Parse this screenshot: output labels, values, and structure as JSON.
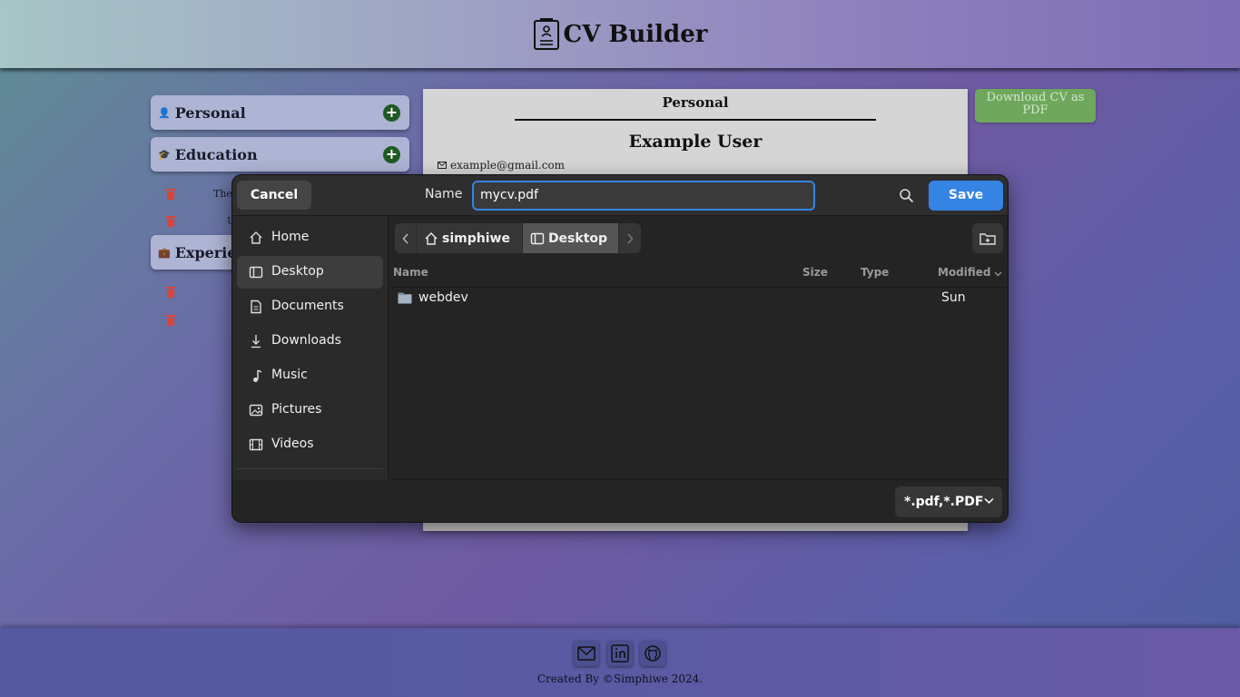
{
  "app": {
    "title": "CV Builder",
    "colors": {
      "add_button": "#1f5a24",
      "delete_icon": "#d9453a",
      "download_button": "#6fa85c"
    }
  },
  "sidebar": {
    "sections": [
      {
        "label": "Personal",
        "icon": "person-icon"
      },
      {
        "label": "Education",
        "icon": "graduation-icon"
      },
      {
        "label": "Experien",
        "icon": "briefcase-icon"
      }
    ],
    "education_entries": [
      "The",
      "U"
    ]
  },
  "cv_preview": {
    "section_title": "Personal",
    "name": "Example User",
    "email": "example@gmail.com"
  },
  "download_button": "Download CV as PDF",
  "footer": {
    "credit": "Created By ©Simphiwe 2024.",
    "links": [
      "mail-icon",
      "linkedin-icon",
      "github-icon"
    ]
  },
  "save_dialog": {
    "cancel_label": "Cancel",
    "name_label": "Name",
    "filename": "mycv.pdf",
    "save_label": "Save",
    "places": [
      "Home",
      "Desktop",
      "Documents",
      "Downloads",
      "Music",
      "Pictures",
      "Videos"
    ],
    "selected_place": "Desktop",
    "path": [
      "simphiwe",
      "Desktop"
    ],
    "columns": {
      "name": "Name",
      "size": "Size",
      "type": "Type",
      "modified": "Modified"
    },
    "files": [
      {
        "name": "webdev",
        "size": "",
        "type": "",
        "modified": "Sun",
        "icon": "folder-icon"
      }
    ],
    "filter": "*.pdf,*.PDF",
    "accent_color": "#3584e4"
  }
}
